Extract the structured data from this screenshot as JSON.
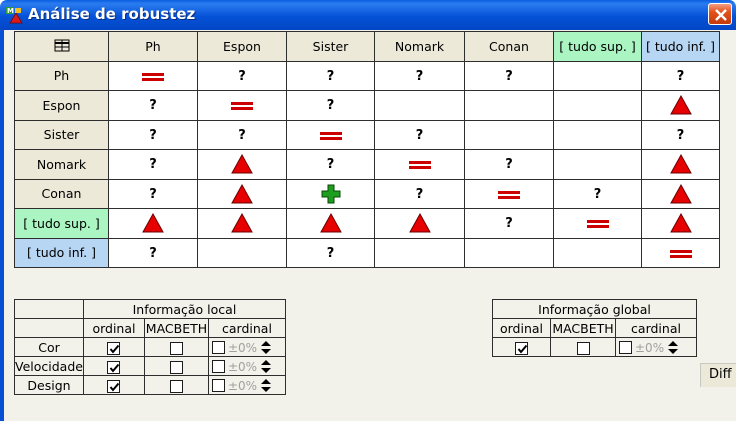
{
  "window": {
    "title": "Análise de robustez",
    "app_icon": "macbeth-app-icon",
    "close_icon": "close-icon",
    "titlebar_color": "#0552d8",
    "close_color": "#e2521b"
  },
  "matrix": {
    "corner_icon": "table-grid-icon",
    "columns": [
      "Ph",
      "Espon",
      "Sister",
      "Nomark",
      "Conan",
      "[ tudo sup. ]",
      "[ tudo inf. ]"
    ],
    "rows": [
      "Ph",
      "Espon",
      "Sister",
      "Nomark",
      "Conan",
      "[ tudo sup. ]",
      "[ tudo inf. ]"
    ],
    "question_mark": "?",
    "legend_symbols": {
      "eq": "equal-icon (red double bar)",
      "tri": "red-triangle-icon",
      "plus": "green-plus-icon",
      "q": "?"
    },
    "cells": [
      [
        "eq",
        "q",
        "q",
        "q",
        "q",
        "",
        "q"
      ],
      [
        "q",
        "eq",
        "q",
        "",
        "",
        "",
        "tri"
      ],
      [
        "q",
        "q",
        "eq",
        "q",
        "",
        "",
        "q"
      ],
      [
        "q",
        "tri",
        "q",
        "eq",
        "q",
        "",
        "tri"
      ],
      [
        "q",
        "tri",
        "plus",
        "q",
        "eq",
        "q",
        "tri"
      ],
      [
        "tri",
        "tri",
        "tri",
        "tri",
        "q",
        "eq",
        "tri"
      ],
      [
        "q",
        "",
        "q",
        "",
        "",
        "",
        "eq"
      ]
    ],
    "colors": {
      "header_bg": "#ece9d8",
      "sup_bg": "#aaf5c2",
      "inf_bg": "#b7d6f4",
      "symbol_red": "#cc0000",
      "symbol_green": "#1e9e1e"
    }
  },
  "local_info": {
    "title": "Informação local",
    "headers": [
      "ordinal",
      "MACBETH",
      "cardinal"
    ],
    "rows": [
      {
        "label": "Cor",
        "ordinal": true,
        "macbeth": false,
        "cardinal": false,
        "pct": "±0%"
      },
      {
        "label": "Velocidade",
        "ordinal": true,
        "macbeth": false,
        "cardinal": false,
        "pct": "±0%"
      },
      {
        "label": "Design",
        "ordinal": true,
        "macbeth": false,
        "cardinal": false,
        "pct": "±0%"
      }
    ]
  },
  "global_info": {
    "title": "Informação global",
    "headers": [
      "ordinal",
      "MACBETH",
      "cardinal"
    ],
    "row": {
      "ordinal": true,
      "macbeth": false,
      "cardinal": false,
      "pct": "±0%"
    }
  },
  "diff_button": {
    "label": "Diff"
  }
}
